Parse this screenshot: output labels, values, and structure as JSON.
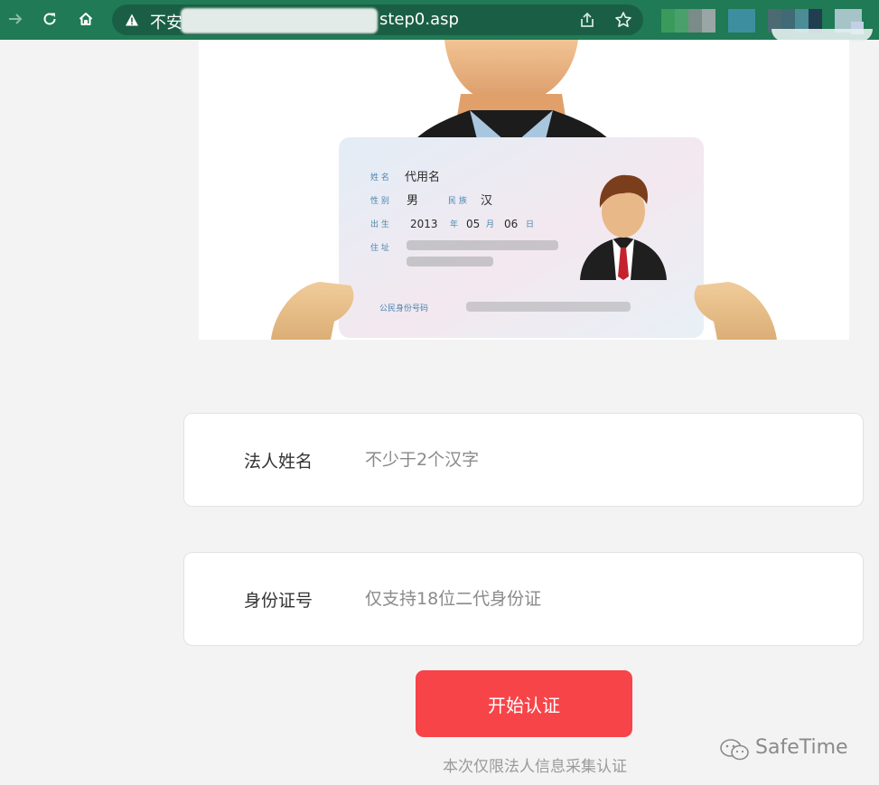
{
  "browser": {
    "url_prefix": "不安",
    "url_suffix": "step0.asp",
    "icons": {
      "forward": "forward-arrow-icon",
      "reload": "reload-icon",
      "home": "home-icon",
      "warning": "warning-triangle-icon",
      "share": "share-icon",
      "bookmark": "star-icon"
    }
  },
  "id_card": {
    "name_label": "姓 名",
    "name_value": "代用名",
    "sex_label": "性 别",
    "sex_value": "男",
    "ethnic_label": "民 族",
    "ethnic_value": "汉",
    "birth_label": "出 生",
    "birth_year": "2013",
    "year_unit": "年",
    "birth_month": "05",
    "month_unit": "月",
    "birth_day": "06",
    "day_unit": "日",
    "address_label": "住 址",
    "id_number_label": "公民身份号码"
  },
  "form": {
    "name_label": "法人姓名",
    "name_placeholder": "不少于2个汉字",
    "id_label": "身份证号",
    "id_placeholder": "仅支持18位二代身份证",
    "submit_label": "开始认证",
    "notice": "本次仅限法人信息采集认证"
  },
  "watermark": {
    "text": "SafeTime",
    "icon": "wechat-icon"
  },
  "colors": {
    "toolbar": "#1f7a55",
    "button": "#f74449",
    "page_bg": "#f3f3f3"
  }
}
